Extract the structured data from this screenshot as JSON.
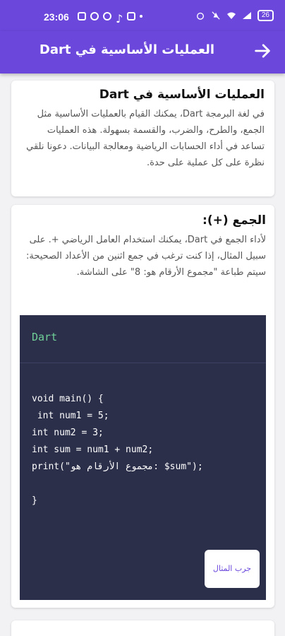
{
  "status": {
    "time": "23:06",
    "battery": "26"
  },
  "app_bar": {
    "title": "العمليات الأساسية في Dart"
  },
  "intro_card": {
    "heading": "العمليات الأساسية في Dart",
    "body": "في لغة البرمجة Dart، يمكنك القيام بالعمليات الأساسية مثل الجمع، والطرح، والضرب، والقسمة بسهولة. هذه العمليات تساعد في أداء الحسابات الرياضية ومعالجة البيانات. دعونا نلقي نظرة على كل عملية على حدة."
  },
  "addition_card": {
    "heading": "الجمع (+):",
    "body": "لأداء الجمع في Dart، يمكنك استخدام العامل الرياضي +. على سبيل المثال، إذا كنت ترغب في جمع اثنين من الأعداد الصحيحة:",
    "note": "سيتم طباعة \"مجموع الأرقام هو: 8\" على الشاشة.",
    "code_lang": "Dart",
    "code": "void main() {\n int num1 = 5;\nint num2 = 3;\nint sum = num1 + num2;\nprint(\"مجموع الأرقام هو: $sum\");\n\n}",
    "try_button": "جرب المثال"
  },
  "colors": {
    "primary": "#6b47dc",
    "code_bg": "#2b2f4a",
    "code_lang": "#6fcf97"
  }
}
